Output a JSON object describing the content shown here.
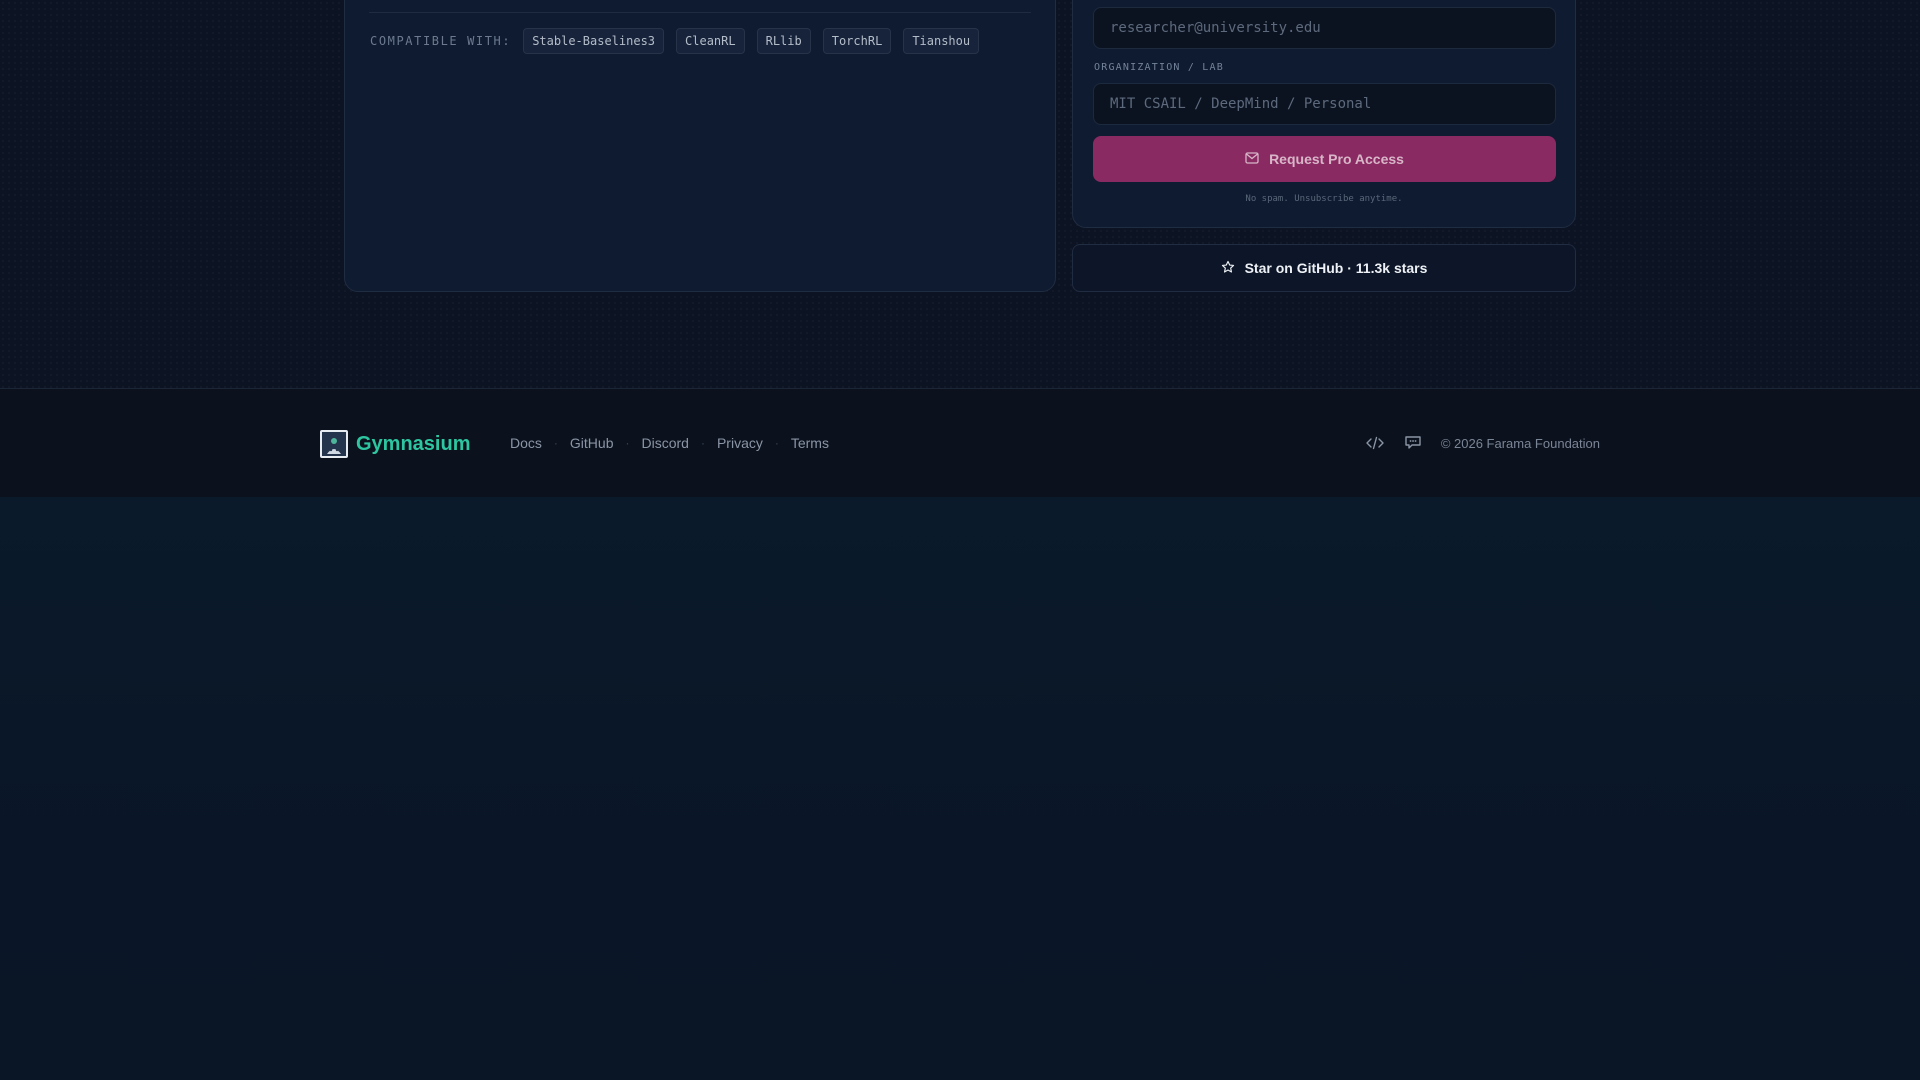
{
  "compat": {
    "label": "COMPATIBLE WITH:",
    "libraries": [
      "Stable-Baselines3",
      "CleanRL",
      "RLlib",
      "TorchRL",
      "Tianshou"
    ]
  },
  "signup": {
    "email_placeholder": "researcher@university.edu",
    "org_label": "ORGANIZATION / LAB",
    "org_placeholder": "MIT CSAIL / DeepMind / Personal",
    "submit_label": "Request Pro Access",
    "note": "No spam. Unsubscribe anytime.",
    "submit_color": "#8a2a63"
  },
  "github_button": {
    "label": "Star on GitHub · 11.3k stars"
  },
  "footer": {
    "brand": "Gymnasium",
    "brand_color": "#2dc6a0",
    "links": [
      "Docs",
      "GitHub",
      "Discord",
      "Privacy",
      "Terms"
    ],
    "icons": [
      "code-icon",
      "chat-icon"
    ],
    "copyright": "© 2026 Farama Foundation"
  }
}
